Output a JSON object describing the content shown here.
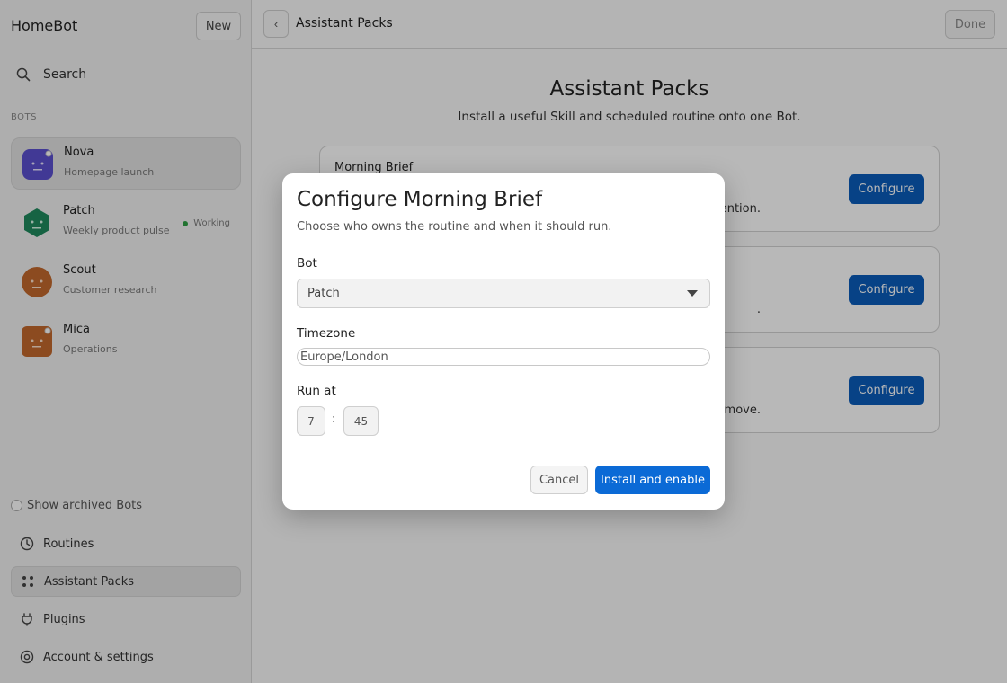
{
  "app": {
    "title": "HomeBot",
    "new_label": "New"
  },
  "search": {
    "label": "Search"
  },
  "sidebar": {
    "section_label": "BOTS",
    "bots": [
      {
        "name": "Nova",
        "subtitle": "Homepage launch",
        "status": "",
        "avatar_color": "#5a4fcf"
      },
      {
        "name": "Patch",
        "subtitle": "Weekly product pulse",
        "status": "Working",
        "avatar_color": "#1f8a5e"
      },
      {
        "name": "Scout",
        "subtitle": "Customer research",
        "status": "",
        "avatar_color": "#c2692d"
      },
      {
        "name": "Mica",
        "subtitle": "Operations",
        "status": "",
        "avatar_color": "#c2692d"
      }
    ],
    "show_archived_label": "Show archived Bots",
    "nav": [
      {
        "label": "Routines",
        "icon": "clock-icon"
      },
      {
        "label": "Assistant Packs",
        "icon": "grid-icon"
      },
      {
        "label": "Plugins",
        "icon": "plugin-icon"
      },
      {
        "label": "Account & settings",
        "icon": "settings-icon"
      }
    ]
  },
  "topbar": {
    "back_label": "‹",
    "title": "Assistant Packs",
    "done_label": "Done"
  },
  "main": {
    "title": "Assistant Packs",
    "subtitle": "Install a useful Skill and scheduled routine onto one Bot.",
    "packs": [
      {
        "name": "Morning Brief",
        "desc_tail": "ention.",
        "configure_label": "Configure"
      },
      {
        "name": "",
        "desc_tail": ".",
        "configure_label": "Configure"
      },
      {
        "name": "",
        "desc_tail": "move.",
        "configure_label": "Configure"
      }
    ]
  },
  "modal": {
    "title": "Configure Morning Brief",
    "subtitle": "Choose who owns the routine and when it should run.",
    "bot_label": "Bot",
    "bot_value": "Patch",
    "timezone_label": "Timezone",
    "timezone_value": "Europe/London",
    "run_at_label": "Run at",
    "hour": "7",
    "separator": ":",
    "minute": "45",
    "cancel_label": "Cancel",
    "install_label": "Install and enable"
  },
  "colors": {
    "accent": "#0b6ad6",
    "status_green": "#2ea043"
  }
}
